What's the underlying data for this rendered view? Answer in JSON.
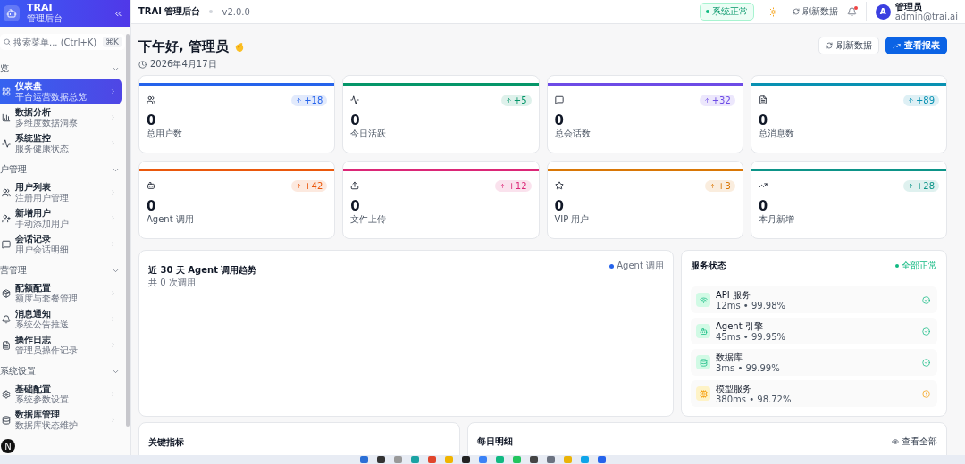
{
  "sidebar": {
    "brand": {
      "title": "TRAI",
      "subtitle": "管理后台"
    },
    "search": {
      "placeholder": "搜索菜单... (Ctrl+K)",
      "shortcut": "⌘K"
    },
    "groups": [
      {
        "label": "览",
        "expanded": true,
        "items": [
          {
            "title": "仪表盘",
            "subtitle": "平台运营数据总览",
            "selected": true
          },
          {
            "title": "数据分析",
            "subtitle": "多维度数据洞察",
            "selected": false
          },
          {
            "title": "系统监控",
            "subtitle": "服务健康状态",
            "selected": false
          }
        ]
      },
      {
        "label": "户管理",
        "expanded": true,
        "items": [
          {
            "title": "用户列表",
            "subtitle": "注册用户管理",
            "selected": false
          },
          {
            "title": "新增用户",
            "subtitle": "手动添加用户",
            "selected": false
          },
          {
            "title": "会话记录",
            "subtitle": "用户会话明细",
            "selected": false
          }
        ]
      },
      {
        "label": "营管理",
        "expanded": true,
        "items": [
          {
            "title": "配额配置",
            "subtitle": "额度与套餐管理",
            "selected": false
          },
          {
            "title": "消息通知",
            "subtitle": "系统公告推送",
            "selected": false
          },
          {
            "title": "操作日志",
            "subtitle": "管理员操作记录",
            "selected": false
          }
        ]
      },
      {
        "label": "系统设置",
        "expanded": true,
        "items": [
          {
            "title": "基础配置",
            "subtitle": "系统参数设置",
            "selected": false
          },
          {
            "title": "数据库管理",
            "subtitle": "数据库状态维护",
            "selected": false
          }
        ]
      }
    ],
    "floating_badge": "N"
  },
  "header": {
    "title": "TRAI 管理后台",
    "version": "v2.0.0",
    "status": "系统正常",
    "refresh": "刷新数据",
    "has_unread": true,
    "user": {
      "initial": "A",
      "name": "管理员",
      "email": "admin@trai.ai"
    }
  },
  "greeting": {
    "title": "下午好, 管理员",
    "date": "2026年4月17日",
    "buttons": [
      {
        "label": "刷新数据",
        "kind": "secondary"
      },
      {
        "label": "查看报表",
        "kind": "primary"
      }
    ]
  },
  "stats": [
    {
      "value": "0",
      "label": "总用户数",
      "delta": "+18",
      "color": "#2563eb"
    },
    {
      "value": "0",
      "label": "今日活跃",
      "delta": "+5",
      "color": "#059669"
    },
    {
      "value": "0",
      "label": "总会话数",
      "delta": "+32",
      "color": "#6d4be6"
    },
    {
      "value": "0",
      "label": "总消息数",
      "delta": "+89",
      "color": "#0891b2"
    },
    {
      "value": "0",
      "label": "Agent 调用",
      "delta": "+42",
      "color": "#ea580c"
    },
    {
      "value": "0",
      "label": "文件上传",
      "delta": "+12",
      "color": "#db2777"
    },
    {
      "value": "0",
      "label": "VIP 用户",
      "delta": "+3",
      "color": "#d97706"
    },
    {
      "value": "0",
      "label": "本月新增",
      "delta": "+28",
      "color": "#0d9488"
    }
  ],
  "trend": {
    "title": "近 30 天 Agent 调用趋势",
    "subtitle": "共 0 次调用",
    "legend": {
      "label": "Agent 调用",
      "color": "#2563eb"
    }
  },
  "services": {
    "title": "服务状态",
    "status": "全部正常",
    "items": [
      {
        "name": "API 服务",
        "metrics": "12ms • 99.98%",
        "kind": "ok"
      },
      {
        "name": "Agent 引擎",
        "metrics": "45ms • 99.95%",
        "kind": "ok"
      },
      {
        "name": "数据库",
        "metrics": "3ms • 99.99%",
        "kind": "ok"
      },
      {
        "name": "模型服务",
        "metrics": "380ms • 98.72%",
        "kind": "warn"
      }
    ]
  },
  "metrics_panel": {
    "title": "关键指标"
  },
  "daily_panel": {
    "title": "每日明细",
    "link": "查看全部"
  }
}
